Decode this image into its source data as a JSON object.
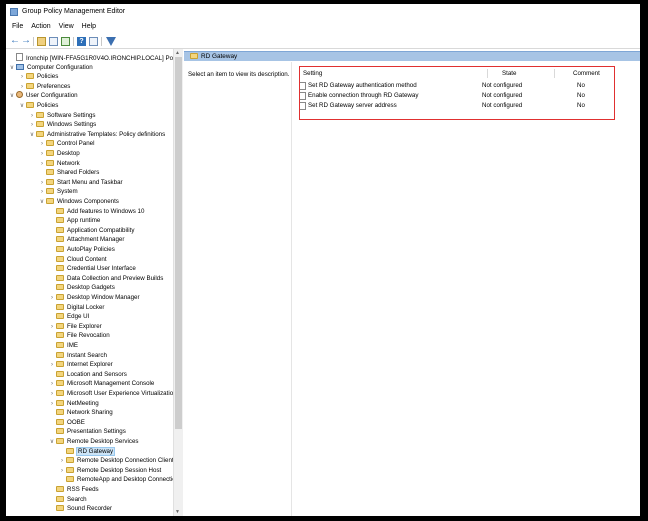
{
  "window": {
    "title": "Group Policy Management Editor"
  },
  "menu": [
    "File",
    "Action",
    "View",
    "Help"
  ],
  "toolbar": {
    "icons": [
      "back-arrow-icon",
      "forward-arrow-icon",
      "folder-up-icon",
      "show-hide-tree-icon",
      "export-list-icon",
      "help-icon",
      "properties-icon",
      "filter-icon"
    ]
  },
  "tree": {
    "items": [
      {
        "label": "Ironchip [WIN-FFA5G1R0V4O.IRONCHIP.LOCAL] Policy",
        "depth": 0,
        "chevron": "",
        "icon": "doc",
        "selected": false
      },
      {
        "label": "Computer Configuration",
        "depth": 0,
        "chevron": "v",
        "icon": "computer",
        "selected": false
      },
      {
        "label": "Policies",
        "depth": 1,
        "chevron": ">",
        "icon": "folder",
        "selected": false
      },
      {
        "label": "Preferences",
        "depth": 1,
        "chevron": ">",
        "icon": "folder",
        "selected": false
      },
      {
        "label": "User Configuration",
        "depth": 0,
        "chevron": "v",
        "icon": "user",
        "selected": false
      },
      {
        "label": "Policies",
        "depth": 1,
        "chevron": "v",
        "icon": "folder",
        "selected": false
      },
      {
        "label": "Software Settings",
        "depth": 2,
        "chevron": ">",
        "icon": "folder",
        "selected": false
      },
      {
        "label": "Windows Settings",
        "depth": 2,
        "chevron": ">",
        "icon": "folder",
        "selected": false
      },
      {
        "label": "Administrative Templates: Policy definitions",
        "depth": 2,
        "chevron": "v",
        "icon": "folder",
        "selected": false
      },
      {
        "label": "Control Panel",
        "depth": 3,
        "chevron": ">",
        "icon": "folder",
        "selected": false
      },
      {
        "label": "Desktop",
        "depth": 3,
        "chevron": ">",
        "icon": "folder",
        "selected": false
      },
      {
        "label": "Network",
        "depth": 3,
        "chevron": ">",
        "icon": "folder",
        "selected": false
      },
      {
        "label": "Shared Folders",
        "depth": 3,
        "chevron": "",
        "icon": "folder",
        "selected": false
      },
      {
        "label": "Start Menu and Taskbar",
        "depth": 3,
        "chevron": ">",
        "icon": "folder",
        "selected": false
      },
      {
        "label": "System",
        "depth": 3,
        "chevron": ">",
        "icon": "folder",
        "selected": false
      },
      {
        "label": "Windows Components",
        "depth": 3,
        "chevron": "v",
        "icon": "folder",
        "selected": false
      },
      {
        "label": "Add features to Windows 10",
        "depth": 4,
        "chevron": "",
        "icon": "folder",
        "selected": false
      },
      {
        "label": "App runtime",
        "depth": 4,
        "chevron": "",
        "icon": "folder",
        "selected": false
      },
      {
        "label": "Application Compatibility",
        "depth": 4,
        "chevron": "",
        "icon": "folder",
        "selected": false
      },
      {
        "label": "Attachment Manager",
        "depth": 4,
        "chevron": "",
        "icon": "folder",
        "selected": false
      },
      {
        "label": "AutoPlay Policies",
        "depth": 4,
        "chevron": "",
        "icon": "folder",
        "selected": false
      },
      {
        "label": "Cloud Content",
        "depth": 4,
        "chevron": "",
        "icon": "folder",
        "selected": false
      },
      {
        "label": "Credential User Interface",
        "depth": 4,
        "chevron": "",
        "icon": "folder",
        "selected": false
      },
      {
        "label": "Data Collection and Preview Builds",
        "depth": 4,
        "chevron": "",
        "icon": "folder",
        "selected": false
      },
      {
        "label": "Desktop Gadgets",
        "depth": 4,
        "chevron": "",
        "icon": "folder",
        "selected": false
      },
      {
        "label": "Desktop Window Manager",
        "depth": 4,
        "chevron": ">",
        "icon": "folder",
        "selected": false
      },
      {
        "label": "Digital Locker",
        "depth": 4,
        "chevron": "",
        "icon": "folder",
        "selected": false
      },
      {
        "label": "Edge UI",
        "depth": 4,
        "chevron": "",
        "icon": "folder",
        "selected": false
      },
      {
        "label": "File Explorer",
        "depth": 4,
        "chevron": ">",
        "icon": "folder",
        "selected": false
      },
      {
        "label": "File Revocation",
        "depth": 4,
        "chevron": "",
        "icon": "folder",
        "selected": false
      },
      {
        "label": "IME",
        "depth": 4,
        "chevron": "",
        "icon": "folder",
        "selected": false
      },
      {
        "label": "Instant Search",
        "depth": 4,
        "chevron": "",
        "icon": "folder",
        "selected": false
      },
      {
        "label": "Internet Explorer",
        "depth": 4,
        "chevron": ">",
        "icon": "folder",
        "selected": false
      },
      {
        "label": "Location and Sensors",
        "depth": 4,
        "chevron": "",
        "icon": "folder",
        "selected": false
      },
      {
        "label": "Microsoft Management Console",
        "depth": 4,
        "chevron": ">",
        "icon": "folder",
        "selected": false
      },
      {
        "label": "Microsoft User Experience Virtualization",
        "depth": 4,
        "chevron": ">",
        "icon": "folder",
        "selected": false
      },
      {
        "label": "NetMeeting",
        "depth": 4,
        "chevron": ">",
        "icon": "folder",
        "selected": false
      },
      {
        "label": "Network Sharing",
        "depth": 4,
        "chevron": "",
        "icon": "folder",
        "selected": false
      },
      {
        "label": "OOBE",
        "depth": 4,
        "chevron": "",
        "icon": "folder",
        "selected": false
      },
      {
        "label": "Presentation Settings",
        "depth": 4,
        "chevron": "",
        "icon": "folder",
        "selected": false
      },
      {
        "label": "Remote Desktop Services",
        "depth": 4,
        "chevron": "v",
        "icon": "folder",
        "selected": false
      },
      {
        "label": "RD Gateway",
        "depth": 5,
        "chevron": "",
        "icon": "folder",
        "selected": true
      },
      {
        "label": "Remote Desktop Connection Client",
        "depth": 5,
        "chevron": ">",
        "icon": "folder",
        "selected": false
      },
      {
        "label": "Remote Desktop Session Host",
        "depth": 5,
        "chevron": ">",
        "icon": "folder",
        "selected": false
      },
      {
        "label": "RemoteApp and Desktop Connections",
        "depth": 5,
        "chevron": "",
        "icon": "folder",
        "selected": false
      },
      {
        "label": "RSS Feeds",
        "depth": 4,
        "chevron": "",
        "icon": "folder",
        "selected": false
      },
      {
        "label": "Search",
        "depth": 4,
        "chevron": "",
        "icon": "folder",
        "selected": false
      },
      {
        "label": "Sound Recorder",
        "depth": 4,
        "chevron": "",
        "icon": "folder",
        "selected": false
      }
    ]
  },
  "pane": {
    "header": "RD Gateway",
    "description": "Select an item to view its description.",
    "columns": {
      "setting": "Setting",
      "state": "State",
      "comment": "Comment"
    },
    "rows": [
      {
        "setting": "Set RD Gateway authentication method",
        "state": "Not configured",
        "comment": "No"
      },
      {
        "setting": "Enable connection through RD Gateway",
        "state": "Not configured",
        "comment": "No"
      },
      {
        "setting": "Set RD Gateway server address",
        "state": "Not configured",
        "comment": "No"
      }
    ],
    "highlight_color": "#e03030"
  }
}
